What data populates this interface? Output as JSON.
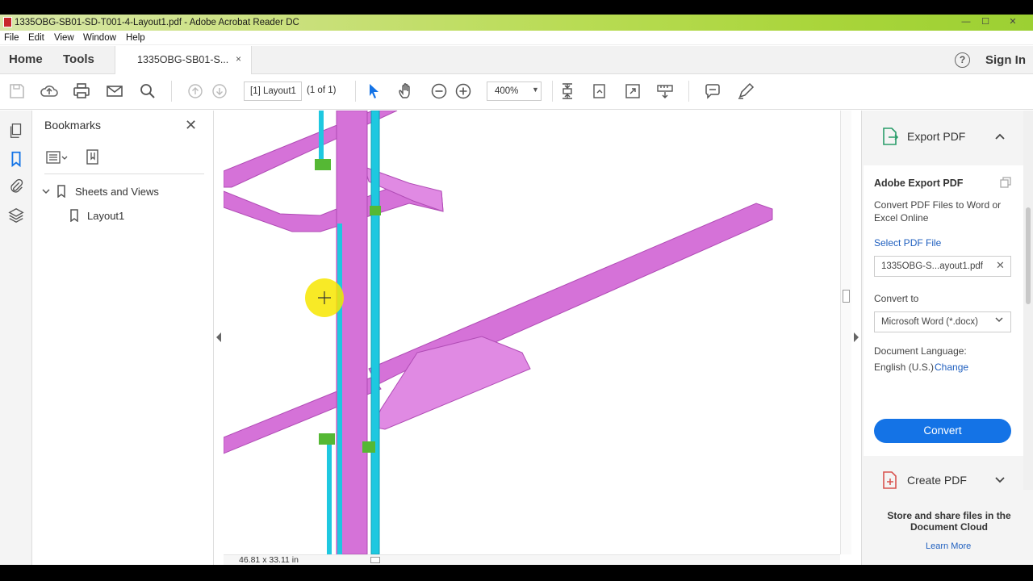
{
  "window": {
    "title": "1335OBG-SB01-SD-T001-4-Layout1.pdf - Adobe Acrobat Reader DC",
    "controls": {
      "minimize": "—",
      "maximize": "☐",
      "close": "✕"
    }
  },
  "menu": {
    "file": "File",
    "edit": "Edit",
    "view": "View",
    "window": "Window",
    "help": "Help"
  },
  "nav": {
    "home": "Home",
    "tools": "Tools",
    "doc_tab": "1335OBG-SB01-S...",
    "doc_tab_close": "×",
    "help": "?",
    "sign_in": "Sign In"
  },
  "toolbar": {
    "page_field": "[1] Layout1",
    "page_count": "(1 of 1)",
    "zoom": "400%"
  },
  "bookmarks": {
    "title": "Bookmarks",
    "close": "✕",
    "items": [
      {
        "label": "Sheets and Views"
      },
      {
        "label": "Layout1"
      }
    ]
  },
  "document": {
    "page_size": "46.81 x 33.11 in"
  },
  "right_pane": {
    "export_header": "Export PDF",
    "panel_title": "Adobe Export PDF",
    "description": "Convert PDF Files to Word or Excel Online",
    "select_label": "Select PDF File",
    "file_name": "1335OBG-S...ayout1.pdf",
    "file_clear": "✕",
    "convert_to_label": "Convert to",
    "format": "Microsoft Word (*.docx)",
    "language_label": "Document Language:",
    "language_value": "English (U.S.)",
    "language_change": "Change",
    "convert_button": "Convert",
    "create_header": "Create PDF",
    "store_text": "Store and share files in the Document Cloud",
    "learn_more": "Learn More"
  },
  "colors": {
    "accent": "#1473e6",
    "cable_tray": "#cc5fd0",
    "riser": "#1ec8e0",
    "hanger": "#55b834",
    "cursor_highlight": "#f7e600"
  }
}
